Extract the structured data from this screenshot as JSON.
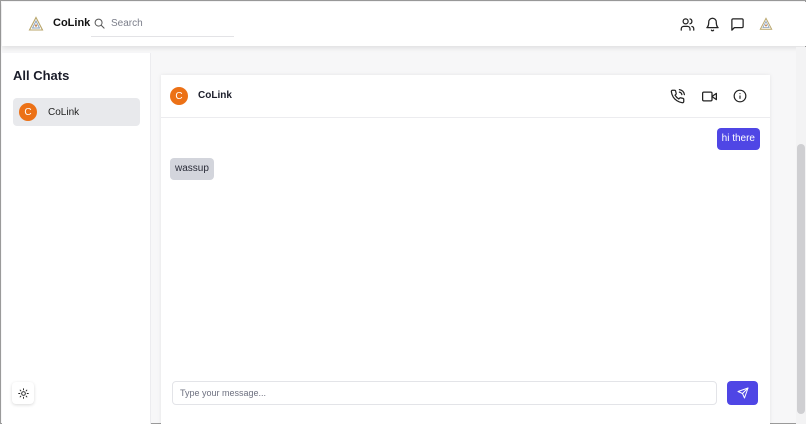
{
  "header": {
    "brand": "CoLink",
    "search_placeholder": "Search",
    "icons": [
      "logo-icon",
      "search-icon",
      "users-icon",
      "bell-icon",
      "message-square-icon",
      "profile-logo-icon"
    ]
  },
  "sidebar": {
    "title": "All Chats",
    "items": [
      {
        "avatar_letter": "C",
        "label": "CoLink"
      }
    ],
    "theme_icon": "sun-icon"
  },
  "chat": {
    "name": "CoLink",
    "avatar_letter": "C",
    "icons": [
      "phone-call-icon",
      "video-icon",
      "info-icon"
    ],
    "messages": [
      {
        "direction": "outgoing",
        "text": "hi there"
      },
      {
        "direction": "incoming",
        "text": "wassup"
      }
    ],
    "composer_placeholder": "Type your message...",
    "send_icon": "send-icon"
  },
  "colors": {
    "accent": "#4f46e5",
    "avatar": "#ec7116",
    "incoming_bubble": "#d3d5dc",
    "active_chat_bg": "#e8e9ec"
  }
}
